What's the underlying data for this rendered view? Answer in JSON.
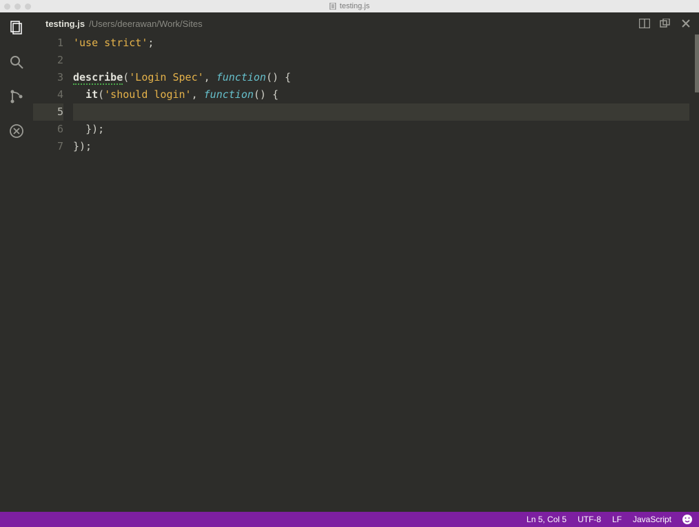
{
  "titlebar": {
    "filename": "testing.js"
  },
  "tab": {
    "filename": "testing.js",
    "path": "/Users/deerawan/Work/Sites"
  },
  "code": {
    "lines": [
      {
        "n": "1",
        "html": "<span class='tok-str'>'use strict'</span><span class='tok-punc'>;</span>"
      },
      {
        "n": "2",
        "html": ""
      },
      {
        "n": "3",
        "html": "<span class='tok-fn underline-green'>describe</span><span class='tok-punc'>(</span><span class='tok-str'>'Login Spec'</span><span class='tok-punc'>, </span><span class='tok-kw tok-it'>function</span><span class='tok-punc'>() {</span>"
      },
      {
        "n": "4",
        "html": "  <span class='tok-fn'>it</span><span class='tok-punc'>(</span><span class='tok-str'>'should login'</span><span class='tok-punc'>, </span><span class='tok-kw tok-it'>function</span><span class='tok-punc'>() {</span>"
      },
      {
        "n": "5",
        "html": "",
        "current": true
      },
      {
        "n": "6",
        "html": "  <span class='tok-punc'>});</span>"
      },
      {
        "n": "7",
        "html": "<span class='tok-punc'>});</span>"
      }
    ]
  },
  "statusbar": {
    "position": "Ln 5, Col 5",
    "encoding": "UTF-8",
    "eol": "LF",
    "language": "JavaScript"
  }
}
